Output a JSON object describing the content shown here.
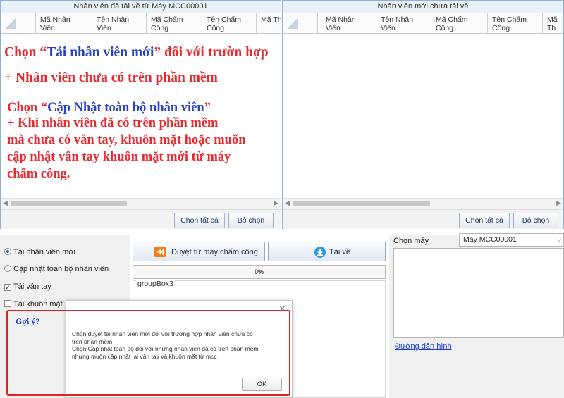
{
  "left_panel": {
    "title": "Nhân viên đã tải về từ Máy MCC00001",
    "columns": [
      "Mã Nhân\nViên",
      "Tên Nhân\nViên",
      "Mã Chấm\nCông",
      "Tên Chấm\nCông",
      "Mã Th"
    ],
    "select_all_label": "Chọn tất cả",
    "deselect_label": "Bỏ chọn"
  },
  "right_panel": {
    "title": "Nhân viên mới chưa tải về",
    "columns": [
      "Mã Nhân\nViên",
      "Tên Nhân\nViên",
      "Mã Chấm\nCông",
      "Tên Chấm\nCông",
      "Mã Th"
    ],
    "select_all_label": "Chọn tất cả",
    "deselect_label": "Bỏ chọn"
  },
  "annotation": {
    "line1_pre": "Chọn “",
    "line1_highlight": "Tải nhân viên mới",
    "line1_post": "” đối với trườn hợp",
    "line2": "+ Nhân viên chưa có trên phần mềm",
    "line3_pre": "Chọn “",
    "line3_highlight": "Cập Nhật toàn bộ nhân viên",
    "line3_post": "”",
    "line4": "+ Khi nhân viên đã có trên phần mềm",
    "line5": "mà chưa có vân tay, khuôn mặt hoặc muốn",
    "line6": "cập nhật vân tay khuôn mặt mới từ máy",
    "line7": "chấm công."
  },
  "options": {
    "radio_new": "Tải nhân viên mới",
    "radio_update_all": "Cập nhật toàn bộ nhân viên",
    "check_fingerprint": "Tải vân tay",
    "check_face": "Tải khuôn mặt",
    "hint_link": "Gợi ý?"
  },
  "actions": {
    "browse_label": "Duyệt từ máy chấm công",
    "download_label": "Tải về",
    "progress_percent": 0,
    "progress_text": "0%",
    "groupbox_label": "groupBox3"
  },
  "device": {
    "label": "Chọn máy",
    "selected": "Máy MCC00001",
    "path_link": "Đường dẫn hình"
  },
  "dialog": {
    "message": "Chọn duyệt tải nhân viên mới đối với trường hợp nhân viên chưa có\ntrên phần mềm\n Chọn Cập nhật toàn bộ đối với những nhân viên đã có trên phần mềm\nnhưng muốn cập nhật lại vân tay và khuôn mặt từ mcc",
    "ok_label": "OK",
    "close_glyph": "✕"
  },
  "colors": {
    "annotation_red": "#e8292f",
    "annotation_blue": "#2741c9",
    "highlight_box": "#dd2228",
    "link_blue": "#1a3cd6"
  },
  "icons": [
    "select-all-corner-icon",
    "import-arrow-icon",
    "download-icon",
    "dropdown-chevron-icon",
    "close-icon",
    "scroll-left-icon",
    "scroll-right-icon"
  ]
}
